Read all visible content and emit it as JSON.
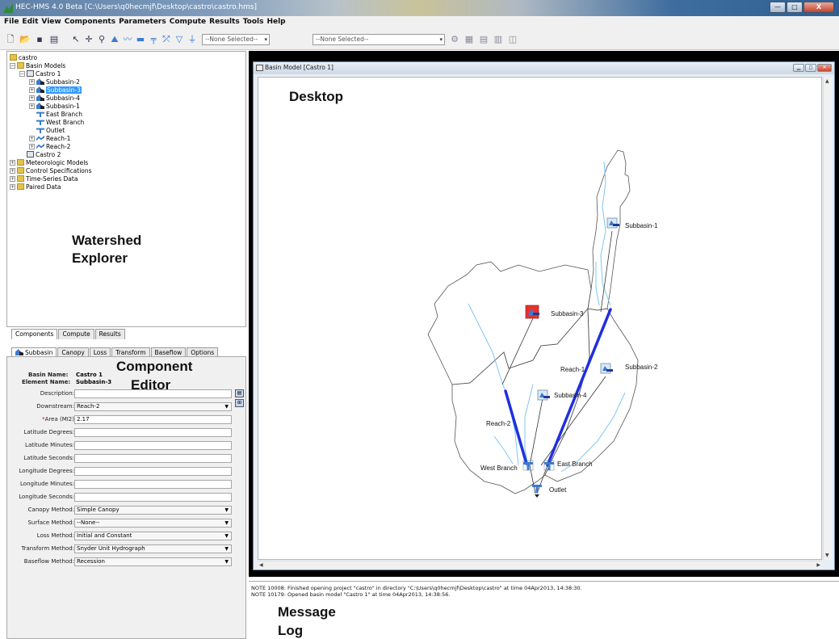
{
  "window": {
    "title": "HEC-HMS 4.0 Beta [C:\\Users\\q0hecmjf\\Desktop\\castro\\castro.hms]",
    "min_label": "—",
    "max_label": "□",
    "close_label": "X"
  },
  "menu": [
    "File",
    "Edit",
    "View",
    "Components",
    "Parameters",
    "Compute",
    "Results",
    "Tools",
    "Help"
  ],
  "toolbar": {
    "select_run": "--None Selected--",
    "select_element": "--None Selected--"
  },
  "tree": {
    "root": "castro",
    "basin_models": "Basin Models",
    "castro1": "Castro 1",
    "items": [
      "Subbasin-2",
      "Subbasin-3",
      "Subbasin-4",
      "Subbasin-1",
      "East Branch",
      "West Branch",
      "Outlet",
      "Reach-1",
      "Reach-2"
    ],
    "castro2": "Castro 2",
    "other": [
      "Meteorologic Models",
      "Control Specifications",
      "Time-Series Data",
      "Paired Data"
    ]
  },
  "annotations": {
    "watershed_explorer_1": "Watershed",
    "watershed_explorer_2": "Explorer",
    "component_editor_1": "Component",
    "component_editor_2": "Editor",
    "desktop": "Desktop",
    "message_log_1": "Message",
    "message_log_2": "Log"
  },
  "explorer_tabs": [
    "Components",
    "Compute",
    "Results"
  ],
  "editor_tabs": [
    "Subbasin",
    "Canopy",
    "Loss",
    "Transform",
    "Baseflow",
    "Options"
  ],
  "editor": {
    "basin_name_label": "Basin Name:",
    "basin_name": "Castro 1",
    "element_name_label": "Element Name:",
    "element_name": "Subbasin-3",
    "description_label": "Description:",
    "downstream_label": "Downstream:",
    "downstream": "Reach-2",
    "area_label": "Area (MI2)",
    "area_required": "*",
    "area": "2.17",
    "lat_deg_label": "Latitude Degrees:",
    "lat_min_label": "Latitude Minutes:",
    "lat_sec_label": "Latitude Seconds:",
    "lon_deg_label": "Longitude Degrees:",
    "lon_min_label": "Longitude Minutes:",
    "lon_sec_label": "Longitude Seconds:",
    "canopy_label": "Canopy Method:",
    "canopy": "Simple Canopy",
    "surface_label": "Surface Method:",
    "surface": "--None--",
    "loss_label": "Loss Method:",
    "loss": "Initial and Constant",
    "transform_label": "Transform Method:",
    "transform": "Snyder Unit Hydrograph",
    "baseflow_label": "Baseflow Method:",
    "baseflow": "Recession"
  },
  "basin_window": {
    "title": "Basin Model [Castro 1]"
  },
  "map": {
    "subbasin1": "Subbasin-1",
    "subbasin2": "Subbasin-2",
    "subbasin3": "Subbasin-3",
    "subbasin4": "Subbasin-4",
    "reach1": "Reach-1",
    "reach2": "Reach-2",
    "west_branch": "West Branch",
    "east_branch": "East Branch",
    "outlet": "Outlet"
  },
  "messages": [
    "NOTE 10008:  Finished opening project \"castro\" in directory \"C:\\Users\\q0hecmjf\\Desktop\\castro\" at time 04Apr2013, 14:38:30.",
    "NOTE 10179:  Opened basin model \"Castro 1\" at time 04Apr2013, 14:38:56."
  ],
  "colors": {
    "reach": "#1f2fe0",
    "stream": "#7ec8f0",
    "selected": "#3399ff",
    "desktop_bg": "#000000"
  }
}
